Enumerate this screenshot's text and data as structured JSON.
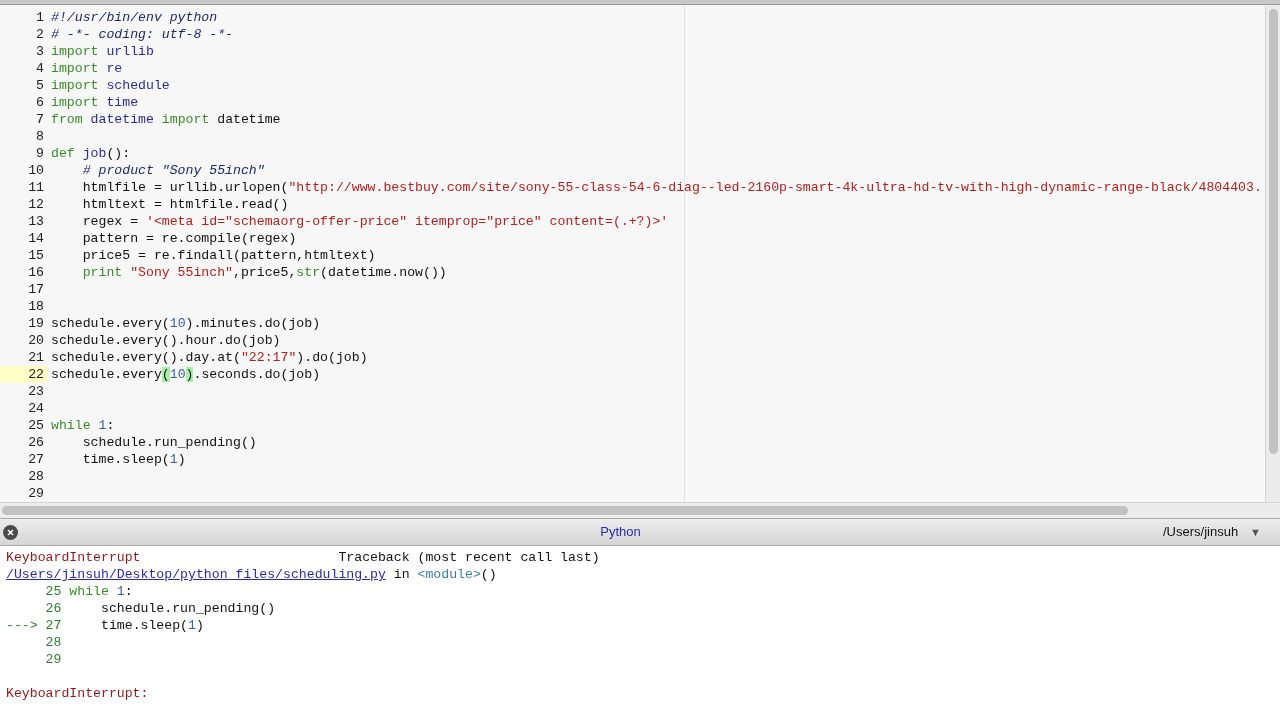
{
  "editor": {
    "lines": [
      {
        "number": "1",
        "current": false,
        "tokens": [
          {
            "kind": "cmt",
            "text": "#!/usr/bin/env python"
          }
        ]
      },
      {
        "number": "2",
        "current": false,
        "tokens": [
          {
            "kind": "cmt",
            "text": "# -*- coding: utf-8 -*-"
          }
        ]
      },
      {
        "number": "3",
        "current": false,
        "tokens": [
          {
            "kind": "kw",
            "text": "import "
          },
          {
            "kind": "name",
            "text": "urllib"
          }
        ]
      },
      {
        "number": "4",
        "current": false,
        "tokens": [
          {
            "kind": "kw",
            "text": "import "
          },
          {
            "kind": "name",
            "text": "re"
          }
        ]
      },
      {
        "number": "5",
        "current": false,
        "tokens": [
          {
            "kind": "kw",
            "text": "import "
          },
          {
            "kind": "name",
            "text": "schedule"
          }
        ]
      },
      {
        "number": "6",
        "current": false,
        "tokens": [
          {
            "kind": "kw",
            "text": "import "
          },
          {
            "kind": "name",
            "text": "time"
          }
        ]
      },
      {
        "number": "7",
        "current": false,
        "tokens": [
          {
            "kind": "kw",
            "text": "from "
          },
          {
            "kind": "name",
            "text": "datetime "
          },
          {
            "kind": "kw",
            "text": "import "
          },
          {
            "kind": "plain",
            "text": "datetime"
          }
        ]
      },
      {
        "number": "8",
        "current": false
      },
      {
        "number": "9",
        "current": false,
        "tokens": [
          {
            "kind": "kw",
            "text": "def "
          },
          {
            "kind": "name",
            "text": "job"
          },
          {
            "kind": "plain",
            "text": "():"
          }
        ]
      },
      {
        "number": "10",
        "current": false,
        "tokens": [
          {
            "kind": "cmt",
            "text": "    # product \"Sony 55inch\""
          }
        ]
      },
      {
        "number": "11",
        "current": false,
        "tokens": [
          {
            "kind": "plain",
            "text": "    htmlfile = urllib.urlopen("
          },
          {
            "kind": "str",
            "text": "\"http://www.bestbuy.com/site/sony-55-class-54-6-diag--led-2160p-smart-4k-ultra-hd-tv-with-high-dynamic-range-black/4804403."
          }
        ]
      },
      {
        "number": "12",
        "current": false,
        "tokens": [
          {
            "kind": "plain",
            "text": "    htmltext = htmlfile.read()"
          }
        ]
      },
      {
        "number": "13",
        "current": false,
        "tokens": [
          {
            "kind": "plain",
            "text": "    regex = "
          },
          {
            "kind": "str",
            "text": "'<meta id=\"schemaorg-offer-price\" itemprop=\"price\" content=(.+?)>'"
          }
        ]
      },
      {
        "number": "14",
        "current": false,
        "tokens": [
          {
            "kind": "plain",
            "text": "    pattern = re.compile(regex)"
          }
        ]
      },
      {
        "number": "15",
        "current": false,
        "tokens": [
          {
            "kind": "plain",
            "text": "    price5 = re.findall(pattern,htmltext)"
          }
        ]
      },
      {
        "number": "16",
        "current": false,
        "tokens": [
          {
            "kind": "kw",
            "text": "    print "
          },
          {
            "kind": "str",
            "text": "\"Sony 55inch\""
          },
          {
            "kind": "plain",
            "text": ",price5,"
          },
          {
            "kind": "kw",
            "text": "str"
          },
          {
            "kind": "plain",
            "text": "(datetime.now())"
          }
        ]
      },
      {
        "number": "17",
        "current": false
      },
      {
        "number": "18",
        "current": false
      },
      {
        "number": "19",
        "current": false,
        "tokens": [
          {
            "kind": "plain",
            "text": "schedule.every("
          },
          {
            "kind": "num",
            "text": "10"
          },
          {
            "kind": "plain",
            "text": ").minutes.do(job)"
          }
        ]
      },
      {
        "number": "20",
        "current": false,
        "tokens": [
          {
            "kind": "plain",
            "text": "schedule.every().hour.do(job)"
          }
        ]
      },
      {
        "number": "21",
        "current": false,
        "tokens": [
          {
            "kind": "plain",
            "text": "schedule.every().day.at("
          },
          {
            "kind": "str",
            "text": "\"22:17\""
          },
          {
            "kind": "plain",
            "text": ").do(job)"
          }
        ]
      },
      {
        "number": "22",
        "current": true,
        "tokens": [
          {
            "kind": "plain",
            "text": "schedule.every"
          },
          {
            "kind": "match",
            "text": "("
          },
          {
            "kind": "num",
            "text": "10"
          },
          {
            "kind": "match",
            "text": ")"
          },
          {
            "kind": "plain",
            "text": ".seconds.do(job)"
          }
        ]
      },
      {
        "number": "23",
        "current": false
      },
      {
        "number": "24",
        "current": false
      },
      {
        "number": "25",
        "current": false,
        "tokens": [
          {
            "kind": "kw",
            "text": "while "
          },
          {
            "kind": "num",
            "text": "1"
          },
          {
            "kind": "plain",
            "text": ":"
          }
        ]
      },
      {
        "number": "26",
        "current": false,
        "tokens": [
          {
            "kind": "plain",
            "text": "    schedule.run_pending()"
          }
        ]
      },
      {
        "number": "27",
        "current": false,
        "tokens": [
          {
            "kind": "plain",
            "text": "    time.sleep("
          },
          {
            "kind": "num",
            "text": "1"
          },
          {
            "kind": "plain",
            "text": ")"
          }
        ]
      },
      {
        "number": "28",
        "current": false
      },
      {
        "number": "29",
        "current": false
      }
    ]
  },
  "console": {
    "title": "Python",
    "path": "/Users/jinsuh",
    "menu_glyph": "▼",
    "lines": [
      {
        "tokens": [
          {
            "kind": "err",
            "text": "KeyboardInterrupt"
          },
          {
            "kind": "plain",
            "text": "                         Traceback (most recent call last)"
          }
        ]
      },
      {
        "tokens": [
          {
            "kind": "link",
            "text": "/Users/jinsuh/Desktop/python files/scheduling.py"
          },
          {
            "kind": "plain",
            "text": " in "
          },
          {
            "kind": "mod",
            "text": "<module>"
          },
          {
            "kind": "plain",
            "text": "()"
          }
        ]
      },
      {
        "tokens": [
          {
            "kind": "lineno",
            "text": "     25 "
          },
          {
            "kind": "kw",
            "text": "while "
          },
          {
            "kind": "num",
            "text": "1"
          },
          {
            "kind": "plain",
            "text": ":"
          }
        ]
      },
      {
        "tokens": [
          {
            "kind": "lineno",
            "text": "     26"
          },
          {
            "kind": "plain",
            "text": "     schedule.run_pending()"
          }
        ]
      },
      {
        "tokens": [
          {
            "kind": "lineno",
            "text": "---> 27"
          },
          {
            "kind": "plain",
            "text": "     time.sleep("
          },
          {
            "kind": "num",
            "text": "1"
          },
          {
            "kind": "plain",
            "text": ")"
          }
        ]
      },
      {
        "tokens": [
          {
            "kind": "lineno",
            "text": "     28"
          }
        ]
      },
      {
        "tokens": [
          {
            "kind": "lineno",
            "text": "     29"
          }
        ]
      }
    ],
    "final_error": [
      {
        "kind": "err",
        "text": "KeyboardInterrupt:"
      }
    ]
  }
}
